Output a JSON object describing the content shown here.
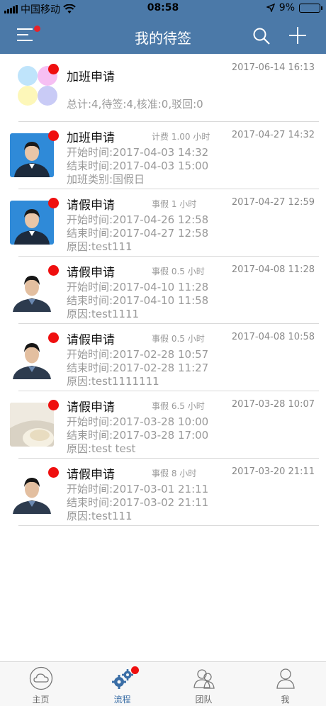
{
  "statusbar": {
    "carrier": "中国移动",
    "time": "08:58",
    "battery": "9%"
  },
  "navbar": {
    "title": "我的待签"
  },
  "summary": {
    "title": "加班申请",
    "date": "2017-06-14 16:13",
    "stats": "总计:4,待签:4,核准:0,驳回:0"
  },
  "items": [
    {
      "title": "加班申请",
      "tag": "计费 1.00 小时",
      "date": "2017-04-27 14:32",
      "lines": [
        "开始时间:2017-04-03 14:32",
        "结束时间:2017-04-03 15:00",
        "加班类别:国假日"
      ]
    },
    {
      "title": "请假申请",
      "tag": "事假 1 小时",
      "date": "2017-04-27 12:59",
      "lines": [
        "开始时间:2017-04-26 12:58",
        "结束时间:2017-04-27 12:58",
        "原因:test111"
      ]
    },
    {
      "title": "请假申请",
      "tag": "事假 0.5 小时",
      "date": "2017-04-08 11:28",
      "lines": [
        "开始时间:2017-04-10 11:28",
        "结束时间:2017-04-10 11:58",
        "原因:test1111"
      ]
    },
    {
      "title": "请假申请",
      "tag": "事假 0.5 小时",
      "date": "2017-04-08 10:58",
      "lines": [
        "开始时间:2017-02-28 10:57",
        "结束时间:2017-02-28 11:27",
        "原因:test1111111"
      ]
    },
    {
      "title": "请假申请",
      "tag": "事假 6.5 小时",
      "date": "2017-03-28 10:07",
      "lines": [
        "开始时间:2017-03-28 10:00",
        "结束时间:2017-03-28 17:00",
        "原因:test test"
      ]
    },
    {
      "title": "请假申请",
      "tag": "事假 8 小时",
      "date": "2017-03-20 21:11",
      "lines": [
        "开始时间:2017-03-01 21:11",
        "结束时间:2017-03-02 21:11",
        "原因:test111"
      ]
    }
  ],
  "tabbar": {
    "tabs": [
      {
        "label": "主页",
        "icon": "cloud-icon"
      },
      {
        "label": "流程",
        "icon": "gears-icon"
      },
      {
        "label": "团队",
        "icon": "team-icon"
      },
      {
        "label": "我",
        "icon": "person-icon"
      }
    ],
    "active_color": "#3a6ea6"
  },
  "colors": {
    "header": "#4b79a8",
    "unread_dot": "#ef0f0f"
  }
}
